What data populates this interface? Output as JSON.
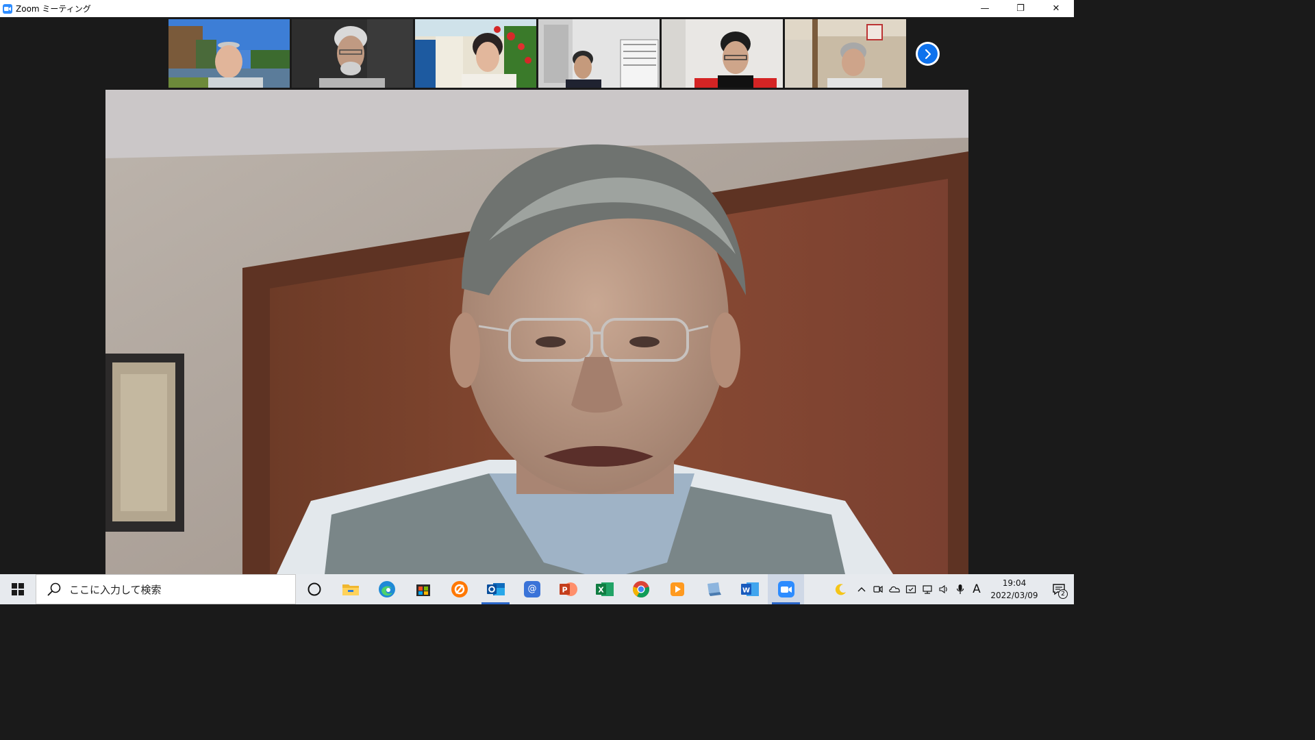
{
  "window": {
    "title": "Zoom ミーティング",
    "controls": {
      "minimize": "—",
      "restore": "❐",
      "close": "✕"
    }
  },
  "gallery": {
    "participants": [
      {
        "id": "p1",
        "scene": "outdoor lake"
      },
      {
        "id": "p2",
        "scene": "dark room"
      },
      {
        "id": "p3",
        "scene": "flower patio"
      },
      {
        "id": "p4",
        "scene": "office"
      },
      {
        "id": "p5",
        "scene": "plain wall"
      },
      {
        "id": "p6",
        "scene": "living room"
      }
    ],
    "next_icon": "chevron-right-icon"
  },
  "speaker": {
    "scene": "active speaker video"
  },
  "taskbar": {
    "search_placeholder": "ここに入力して検索",
    "apps": [
      {
        "name": "task-view-icon"
      },
      {
        "name": "file-explorer-icon"
      },
      {
        "name": "edge-icon"
      },
      {
        "name": "microsoft-store-icon"
      },
      {
        "name": "avast-icon"
      },
      {
        "name": "outlook-icon"
      },
      {
        "name": "at-menu-icon"
      },
      {
        "name": "powerpoint-icon"
      },
      {
        "name": "excel-icon"
      },
      {
        "name": "chrome-icon"
      },
      {
        "name": "media-player-icon"
      },
      {
        "name": "network-app-icon"
      },
      {
        "name": "word-icon"
      },
      {
        "name": "zoom-icon"
      }
    ],
    "tray": {
      "ime": "A",
      "time": "19:04",
      "date": "2022/03/09",
      "notification_count": "2"
    }
  },
  "colors": {
    "zoom_blue": "#2d8cff",
    "next_button": "#0e72ed",
    "taskbar": "#e7eaee"
  }
}
